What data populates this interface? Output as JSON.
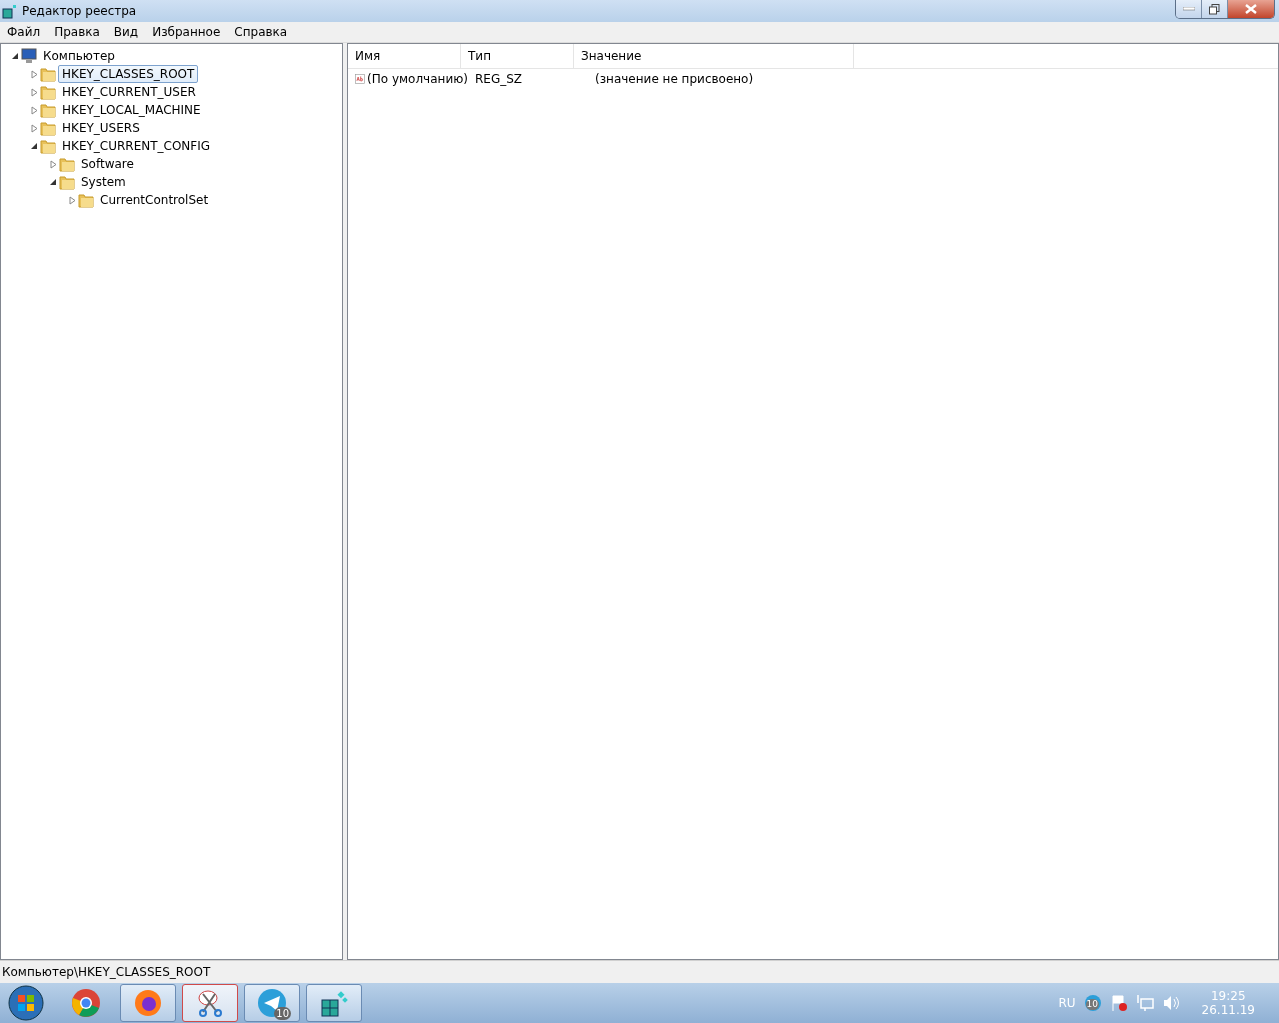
{
  "window": {
    "title": "Редактор реестра"
  },
  "menu": [
    "Файл",
    "Правка",
    "Вид",
    "Избранное",
    "Справка"
  ],
  "tree": {
    "label": "Компьютер",
    "kind": "computer",
    "expanded": true,
    "selected": false,
    "children": [
      {
        "label": "HKEY_CLASSES_ROOT",
        "kind": "folder",
        "expanded": false,
        "selected": true
      },
      {
        "label": "HKEY_CURRENT_USER",
        "kind": "folder",
        "expanded": false,
        "selected": false
      },
      {
        "label": "HKEY_LOCAL_MACHINE",
        "kind": "folder",
        "expanded": false,
        "selected": false
      },
      {
        "label": "HKEY_USERS",
        "kind": "folder",
        "expanded": false,
        "selected": false
      },
      {
        "label": "HKEY_CURRENT_CONFIG",
        "kind": "folder",
        "expanded": true,
        "selected": false,
        "children": [
          {
            "label": "Software",
            "kind": "folder",
            "expanded": false,
            "selected": false
          },
          {
            "label": "System",
            "kind": "folder",
            "expanded": true,
            "selected": false,
            "children": [
              {
                "label": "CurrentControlSet",
                "kind": "folder",
                "expanded": false,
                "selected": false
              }
            ]
          }
        ]
      }
    ]
  },
  "table": {
    "columns": [
      "Имя",
      "Тип",
      "Значение"
    ],
    "rows": [
      {
        "name": "(По умолчанию)",
        "type": "REG_SZ",
        "value": "(значение не присвоено)"
      }
    ]
  },
  "status_bar": "Компьютер\\HKEY_CLASSES_ROOT",
  "taskbar": {
    "apps": [
      {
        "kind": "browser-round",
        "running": false,
        "selected": false
      },
      {
        "kind": "browser-fox",
        "running": true,
        "selected": false
      },
      {
        "kind": "scissors",
        "running": true,
        "selected": true
      },
      {
        "kind": "messenger",
        "running": true,
        "selected": false,
        "badge": "10"
      },
      {
        "kind": "cubes",
        "running": true,
        "selected": false
      }
    ],
    "language": "RU",
    "tray_badge": "10",
    "time": "19:25",
    "date": "26.11.19"
  }
}
